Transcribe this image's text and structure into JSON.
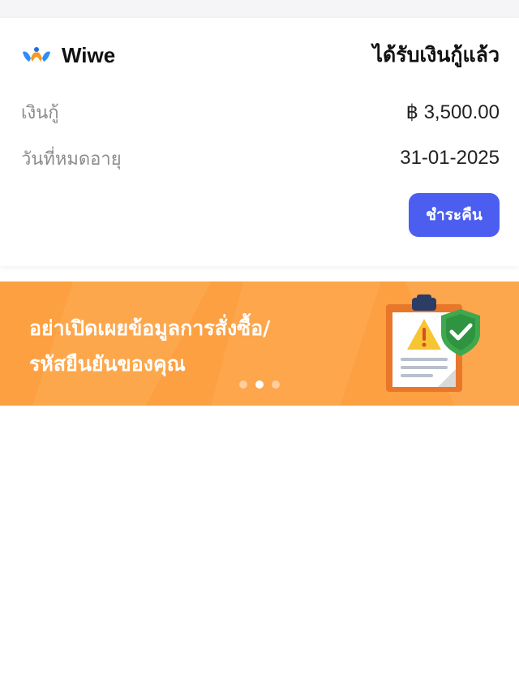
{
  "brand": {
    "name": "Wiwe",
    "logo_icon": "wiwe-logo-icon"
  },
  "loan": {
    "status": "ได้รับเงินกู้แล้ว",
    "amount_label": "เงินกู้",
    "amount_value": "฿ 3,500.00",
    "expiry_label": "วันที่หมดอายุ",
    "expiry_value": "31-01-2025",
    "repay_button": "ชำระคืน"
  },
  "banner": {
    "line1": "อย่าเปิดเผยข้อมูลการสั่งซื้อ/",
    "line2": "รหัสยืนยันของคุณ",
    "illustration_icon": "clipboard-warning-shield-icon",
    "pages": 3,
    "active_page": 2
  },
  "colors": {
    "accent_button": "#4b5ef0",
    "banner_bg": "#fca042",
    "text_primary": "#111111",
    "text_muted": "#8c8c8c"
  }
}
